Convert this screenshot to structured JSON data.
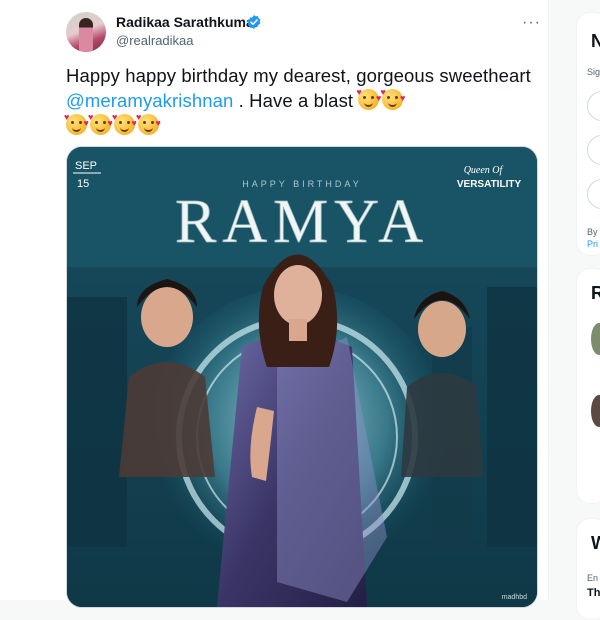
{
  "tweet": {
    "author_name": "Radikaa Sarathkumar",
    "author_handle": "@realradikaa",
    "more_label": "···",
    "text_part1": "Happy happy birthday my dearest, gorgeous sweetheart ",
    "mention": "@meramyakrishnan",
    "text_part2": " . Have a blast ",
    "emoji": "smiling-face-with-hearts"
  },
  "poster": {
    "date_month": "SEP",
    "date_day": "15",
    "tagline": "HAPPY BIRTHDAY",
    "title": "RAMYA",
    "badge_script": "Queen Of",
    "badge_text": "VERSATILITY",
    "credit": "madhbd"
  },
  "sidebar": {
    "card1_letter": "N",
    "card1_sub": "Sig",
    "card1_by": "By",
    "card1_pri": "Pri",
    "card2_letter": "R",
    "card3_letter": "W",
    "card3_sub": "En",
    "card3_th": "Th"
  },
  "colors": {
    "link": "#1d9bf0",
    "verified": "#1d9bf0",
    "poster_bg": "#1a5f73"
  }
}
